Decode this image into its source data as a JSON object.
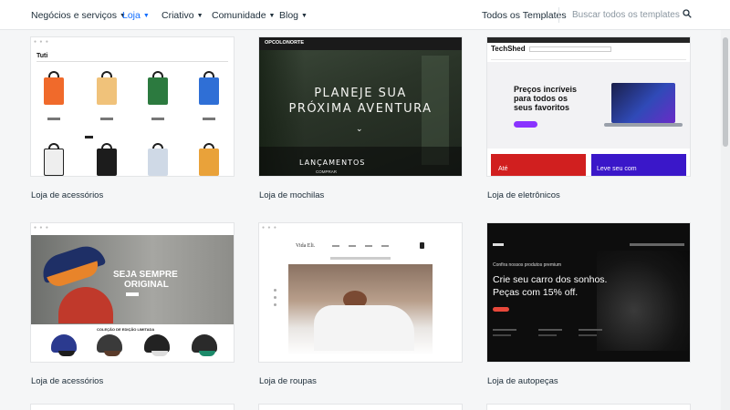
{
  "nav": {
    "items": [
      {
        "label": "Negócios e serviços"
      },
      {
        "label": "Loja"
      },
      {
        "label": "Criativo"
      },
      {
        "label": "Comunidade"
      },
      {
        "label": "Blog"
      }
    ],
    "all_templates": "Todos os Templates",
    "search_placeholder": "Buscar todos os templates...",
    "active_item": "Loja",
    "accent_color": "#116dff"
  },
  "cards": [
    {
      "label": "Loja de acessórios",
      "preview": {
        "brand": "Tuti"
      }
    },
    {
      "label": "Loja de mochilas",
      "preview": {
        "brand": "OPCOLONORTE",
        "headline1": "PLANEJE SUA",
        "headline2": "PRÓXIMA AVENTURA",
        "section": "LANÇAMENTOS",
        "section_sub": "COMPRAR"
      }
    },
    {
      "label": "Loja de eletrônicos",
      "preview": {
        "brand": "TechShed",
        "headline1": "Preços incríveis",
        "headline2": "para todos os",
        "headline3": "seus favoritos",
        "promo1": "Até",
        "promo2": "Leve seu com"
      }
    },
    {
      "label": "Loja de acessórios",
      "preview": {
        "headline1": "SEJA SEMPRE",
        "headline2": "ORIGINAL",
        "collection": "COLEÇÃO DE EDIÇÃO LIMITADA"
      }
    },
    {
      "label": "Loja de roupas",
      "preview": {
        "brand": "Vida Eli."
      }
    },
    {
      "label": "Loja de autopeças",
      "preview": {
        "kicker": "Confira nossos produtos premium",
        "headline1": "Crie seu carro dos sonhos.",
        "headline2": "Peças com 15% off."
      }
    }
  ]
}
